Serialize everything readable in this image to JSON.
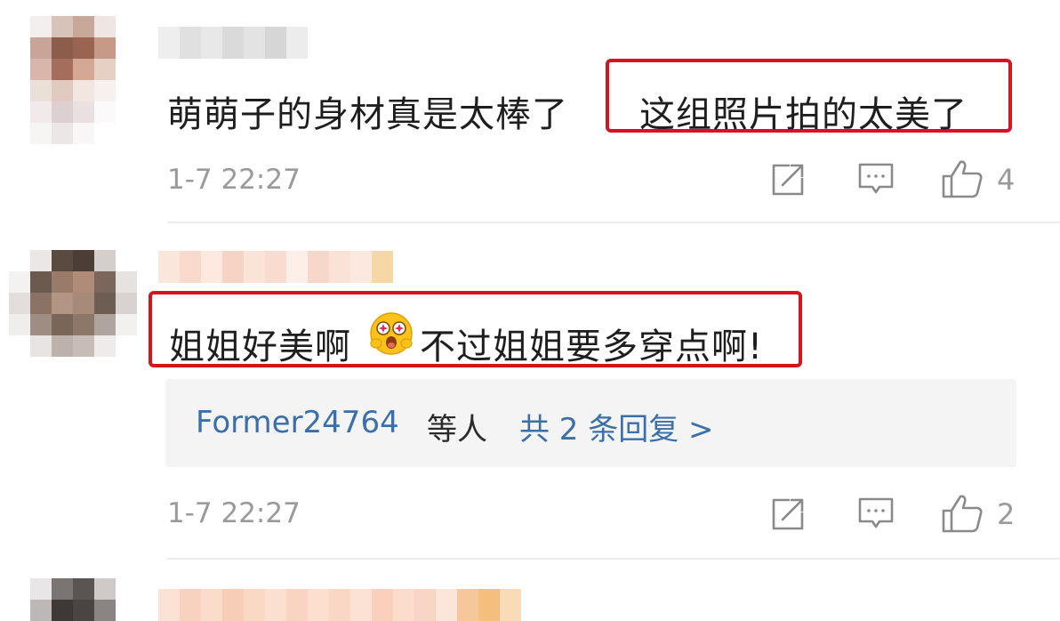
{
  "comments": [
    {
      "text_part1": "萌萌子的身材真是太棒了",
      "text_highlight": "这组照片拍的太美了",
      "time": "1-7 22:27",
      "likes": "4"
    },
    {
      "text_part1": "姐姐好美啊",
      "emoji": "astonished-face-emoji",
      "text_part2": "不过姐姐要多穿点啊!",
      "time": "1-7 22:27",
      "likes": "2",
      "replies": {
        "user": "Former24764",
        "etc": "等人",
        "link": "共 2 条回复 >"
      }
    }
  ],
  "icons": {
    "repost": "share-icon",
    "comment": "comment-icon",
    "like": "thumb-up-icon"
  },
  "colors": {
    "highlight_border": "#d8121e",
    "link": "#3a6fa9",
    "meta": "#9a9a9a"
  }
}
